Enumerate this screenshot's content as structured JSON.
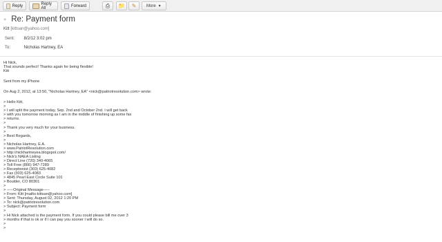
{
  "toolbar": {
    "reply": "Reply",
    "reply_all": "Reply All",
    "forward": "Forward",
    "more": "More",
    "icons": [
      "reply-icon",
      "reply-all-icon",
      "forward-icon",
      "print-icon",
      "folder-icon",
      "edit-icon"
    ]
  },
  "message": {
    "subject": "Re: Payment form",
    "from_name": "Kitt",
    "from_addr": "[kittsan@yahoo.com]",
    "sent_label": "Sent:",
    "sent_value": "8/2/12 3:02 pm",
    "to_label": "To:",
    "to_value": "Nicholas Hartney, EA",
    "body_lines": [
      "Hi Nick,",
      "That sounds perfect! Thanks again for being flexible!",
      "Kitt",
      "",
      "Sent from my iPhone",
      "",
      "On Aug 2, 2012, at 13:50, \"Nicholas Hartney, EA\" <nick@patriotresolution.com> wrote:",
      "",
      "> Hello Kitt,",
      ">",
      "> I will split the payment today, Sep. 2nd and October 2nd. I will get back",
      "> with you tomorrow morning as I am in the middle of finishing up some fax",
      "> returns.",
      ">",
      "> Thank you very much for your business.",
      ">",
      "> Best Regards,",
      ">",
      "> Nicholas Hartney, E.A.",
      "> www.PatriotResolution.com",
      "> http://nickhartneyea.blogspot.com/",
      "> Nick's NAEA Listing",
      "> Direct Line (720) 340-4065",
      "> Toll Free (866) 947-7289",
      "> Receptionist (303) 625-4082",
      "> Fax (303) 625-4083",
      "> 4845 Pearl East Circle Suite 101",
      "> Boulder, CO 80301",
      ">",
      "> -----Original Message-----",
      "> From: Kitt [mailto:kittsan@yahoo.com]",
      "> Sent: Thursday, August 02, 2012 1:20 PM",
      "> To: nick@patriotresolution.com",
      "> Subject: Payment form",
      ">",
      "> Hi Nick attached is the payment form. If you could please bill me over 3",
      "> months if that is ok or if I can pay you sooner I will do so.",
      ">",
      ">"
    ]
  }
}
